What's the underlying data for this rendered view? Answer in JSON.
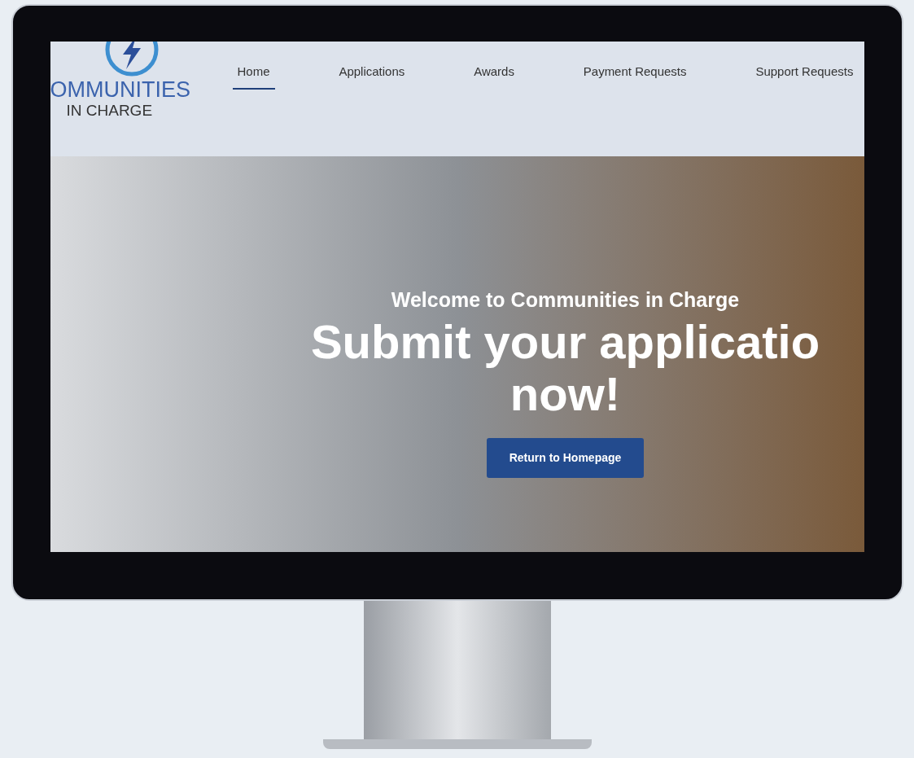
{
  "logo": {
    "line_1": "OMMUNITIES",
    "line_2": "IN CHARGE"
  },
  "nav": [
    {
      "label": "Home",
      "selected": true
    },
    {
      "label": "Applications",
      "selected": false
    },
    {
      "label": "Awards",
      "selected": false
    },
    {
      "label": "Payment Requests",
      "selected": false
    },
    {
      "label": "Support Requests",
      "selected": false
    }
  ],
  "hero": {
    "subtitle": "Welcome to Communities in Charge",
    "headline": [
      "Submit your applicatio",
      "now!"
    ],
    "button": "Return to Homepage"
  }
}
